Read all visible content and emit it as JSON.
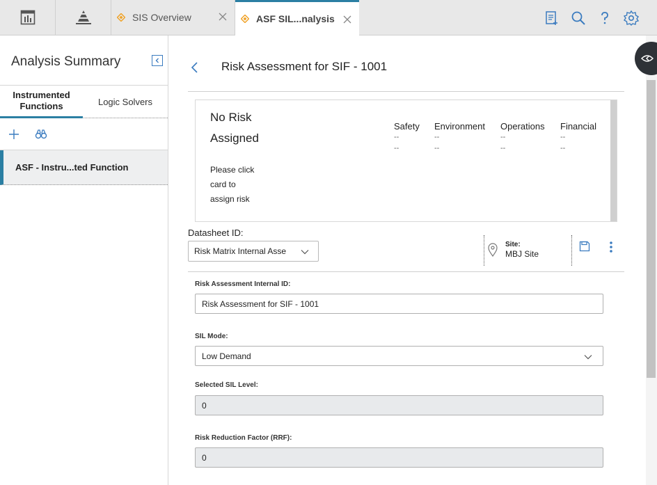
{
  "tabs": {
    "inactive_label": "SIS Overview",
    "active_label": "ASF SIL...nalysis"
  },
  "left_panel": {
    "title": "Analysis Summary",
    "tab_instrumented": "Instrumented Functions",
    "tab_logic": "Logic Solvers",
    "items": [
      {
        "label": "ASF - Instru...ted Function"
      }
    ]
  },
  "main": {
    "title": "Risk Assessment for SIF - 1001",
    "risk_card": {
      "no_risk": "No Risk Assigned",
      "hint": "Please click card to assign risk",
      "columns": [
        {
          "name": "Safety",
          "v1": "--",
          "v2": "--"
        },
        {
          "name": "Environment",
          "v1": "--",
          "v2": "--"
        },
        {
          "name": "Operations",
          "v1": "--",
          "v2": "--"
        },
        {
          "name": "Financial",
          "v1": "--",
          "v2": "--"
        }
      ]
    },
    "datasheet_label": "Datasheet ID:",
    "datasheet_value": "Risk Matrix Internal Asse",
    "site_label": "Site:",
    "site_value": "MBJ Site",
    "fields": {
      "internal_id_label": "Risk Assessment Internal ID:",
      "internal_id_value": "Risk Assessment for SIF - 1001",
      "sil_mode_label": "SIL Mode:",
      "sil_mode_value": "Low Demand",
      "selected_sil_label": "Selected SIL Level:",
      "selected_sil_value": "0",
      "rrf_label": "Risk Reduction Factor (RRF):",
      "rrf_value": "0"
    }
  },
  "colors": {
    "accent": "#2b7fa3",
    "diamond": "#f0a32a",
    "icon_blue": "#3a7bbf"
  },
  "icons": [
    "dashboard-icon",
    "pyramid-icon",
    "diamond-icon",
    "close-icon",
    "report-icon",
    "search-icon",
    "help-icon",
    "gear-icon",
    "collapse-icon",
    "add-icon",
    "binoculars-icon",
    "back-icon",
    "chevron-down-icon",
    "location-pin-icon",
    "save-icon",
    "more-vertical-icon",
    "side-panel-icon"
  ]
}
